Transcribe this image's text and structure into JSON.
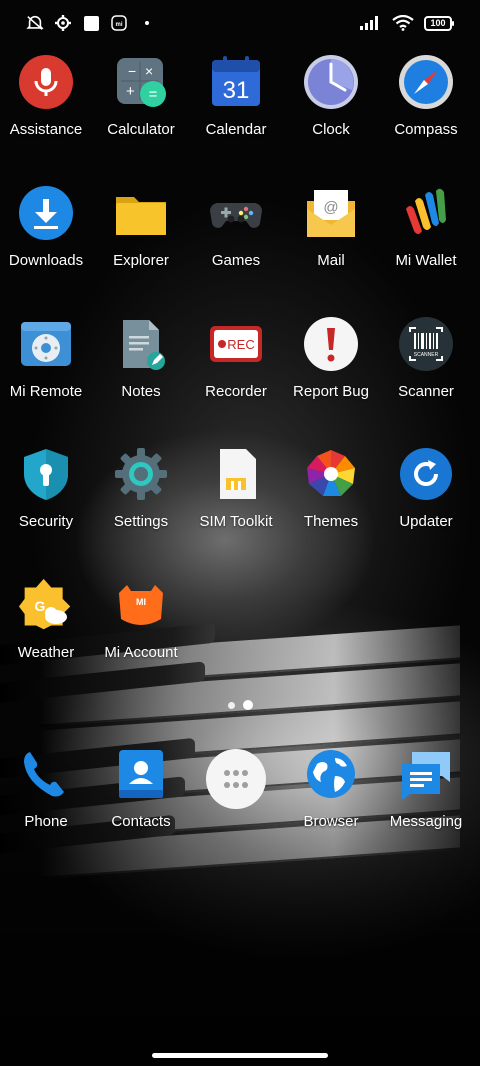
{
  "status_bar": {
    "battery_level": "100",
    "icons_left": [
      "mute-icon",
      "settings-gear-icon",
      "white-square-icon",
      "mi-icon",
      "dot-icon"
    ],
    "icons_right": [
      "signal-icon",
      "wifi-icon",
      "battery-icon"
    ]
  },
  "apps": {
    "assistance": "Assistance",
    "calculator": "Calculator",
    "calendar": "Calendar",
    "calendar_day": "31",
    "clock": "Clock",
    "compass": "Compass",
    "downloads": "Downloads",
    "explorer": "Explorer",
    "games": "Games",
    "mail": "Mail",
    "mi_wallet": "Mi Wallet",
    "mi_remote": "Mi Remote",
    "notes": "Notes",
    "recorder": "Recorder",
    "recorder_badge": "REC",
    "report_bug": "Report Bug",
    "scanner": "Scanner",
    "scanner_badge": "SCANNER",
    "security": "Security",
    "settings": "Settings",
    "sim_toolkit": "SIM Toolkit",
    "themes": "Themes",
    "updater": "Updater",
    "weather": "Weather",
    "mi_account": "Mi Account",
    "mi_account_badge": "MI"
  },
  "dock": {
    "phone": "Phone",
    "contacts": "Contacts",
    "browser": "Browser",
    "messaging": "Messaging"
  },
  "pager": {
    "pages": 2,
    "current": 2
  },
  "colors": {
    "assistance_red": "#d93a2f",
    "calendar_blue": "#2f6bd8",
    "downloads_blue": "#1e88e5",
    "folder_yellow": "#f7c52b",
    "security_teal": "#22a6c9",
    "updater_blue": "#1976d2"
  }
}
